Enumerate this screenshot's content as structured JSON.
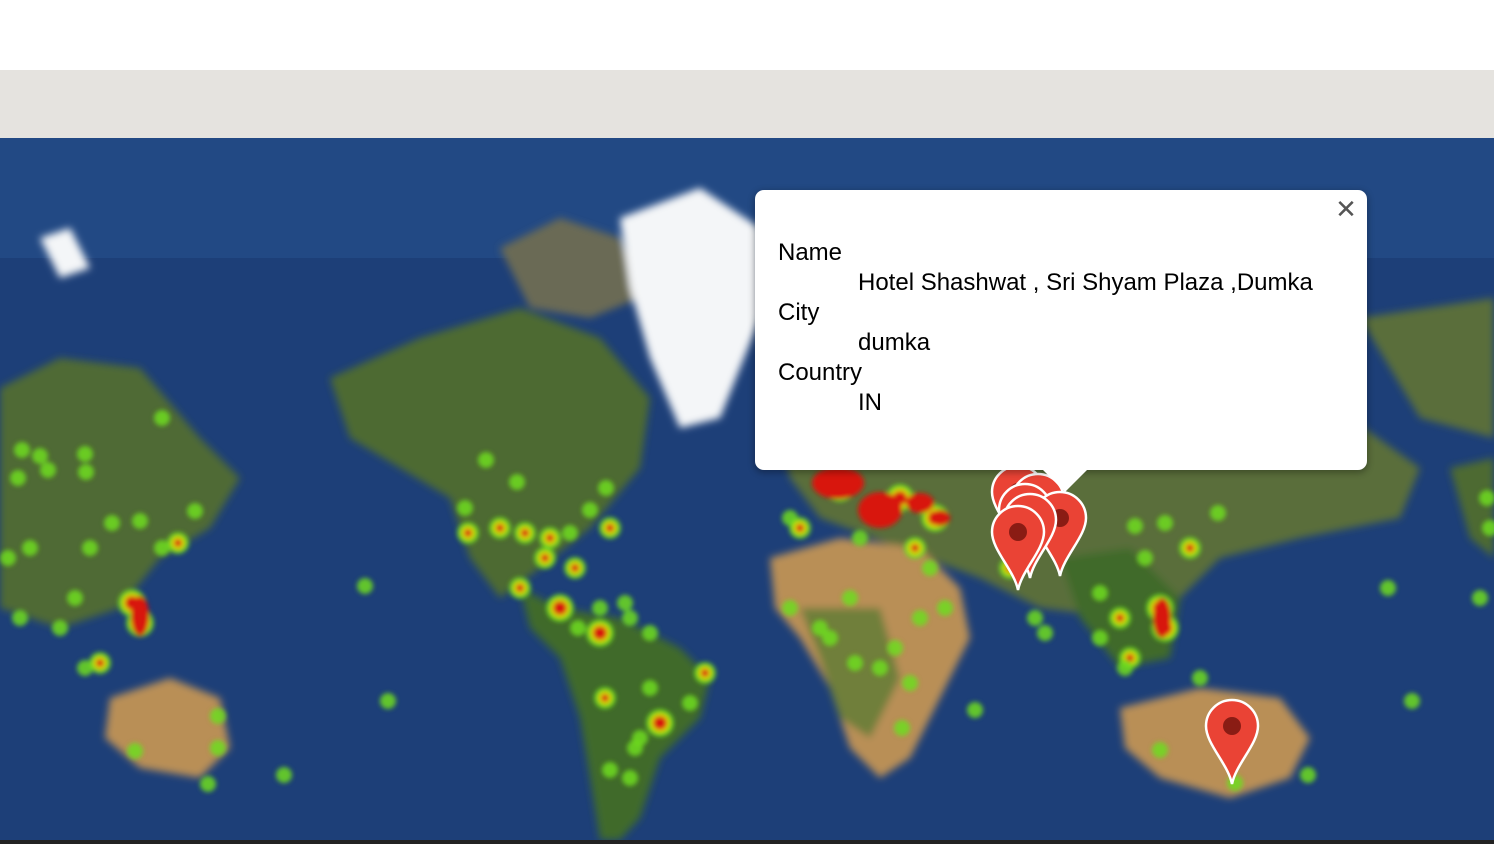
{
  "info_window": {
    "close_icon": "close-icon",
    "fields": [
      {
        "label": "Name",
        "value": "Hotel Shashwat , Sri Shyam Plaza ,Dumka"
      },
      {
        "label": "City",
        "value": "dumka"
      },
      {
        "label": "Country",
        "value": "IN"
      }
    ]
  },
  "map": {
    "type": "satellite",
    "layers": [
      "heatmap",
      "markers"
    ],
    "colors": {
      "ocean": "#1d3f78",
      "land": "#4e6b33",
      "desert": "#b98f57",
      "ice": "#f4f6f8",
      "heat_low": "#6fdc1f",
      "heat_mid": "#e6e600",
      "heat_high": "#d8160e",
      "marker": "#ea4335"
    }
  }
}
